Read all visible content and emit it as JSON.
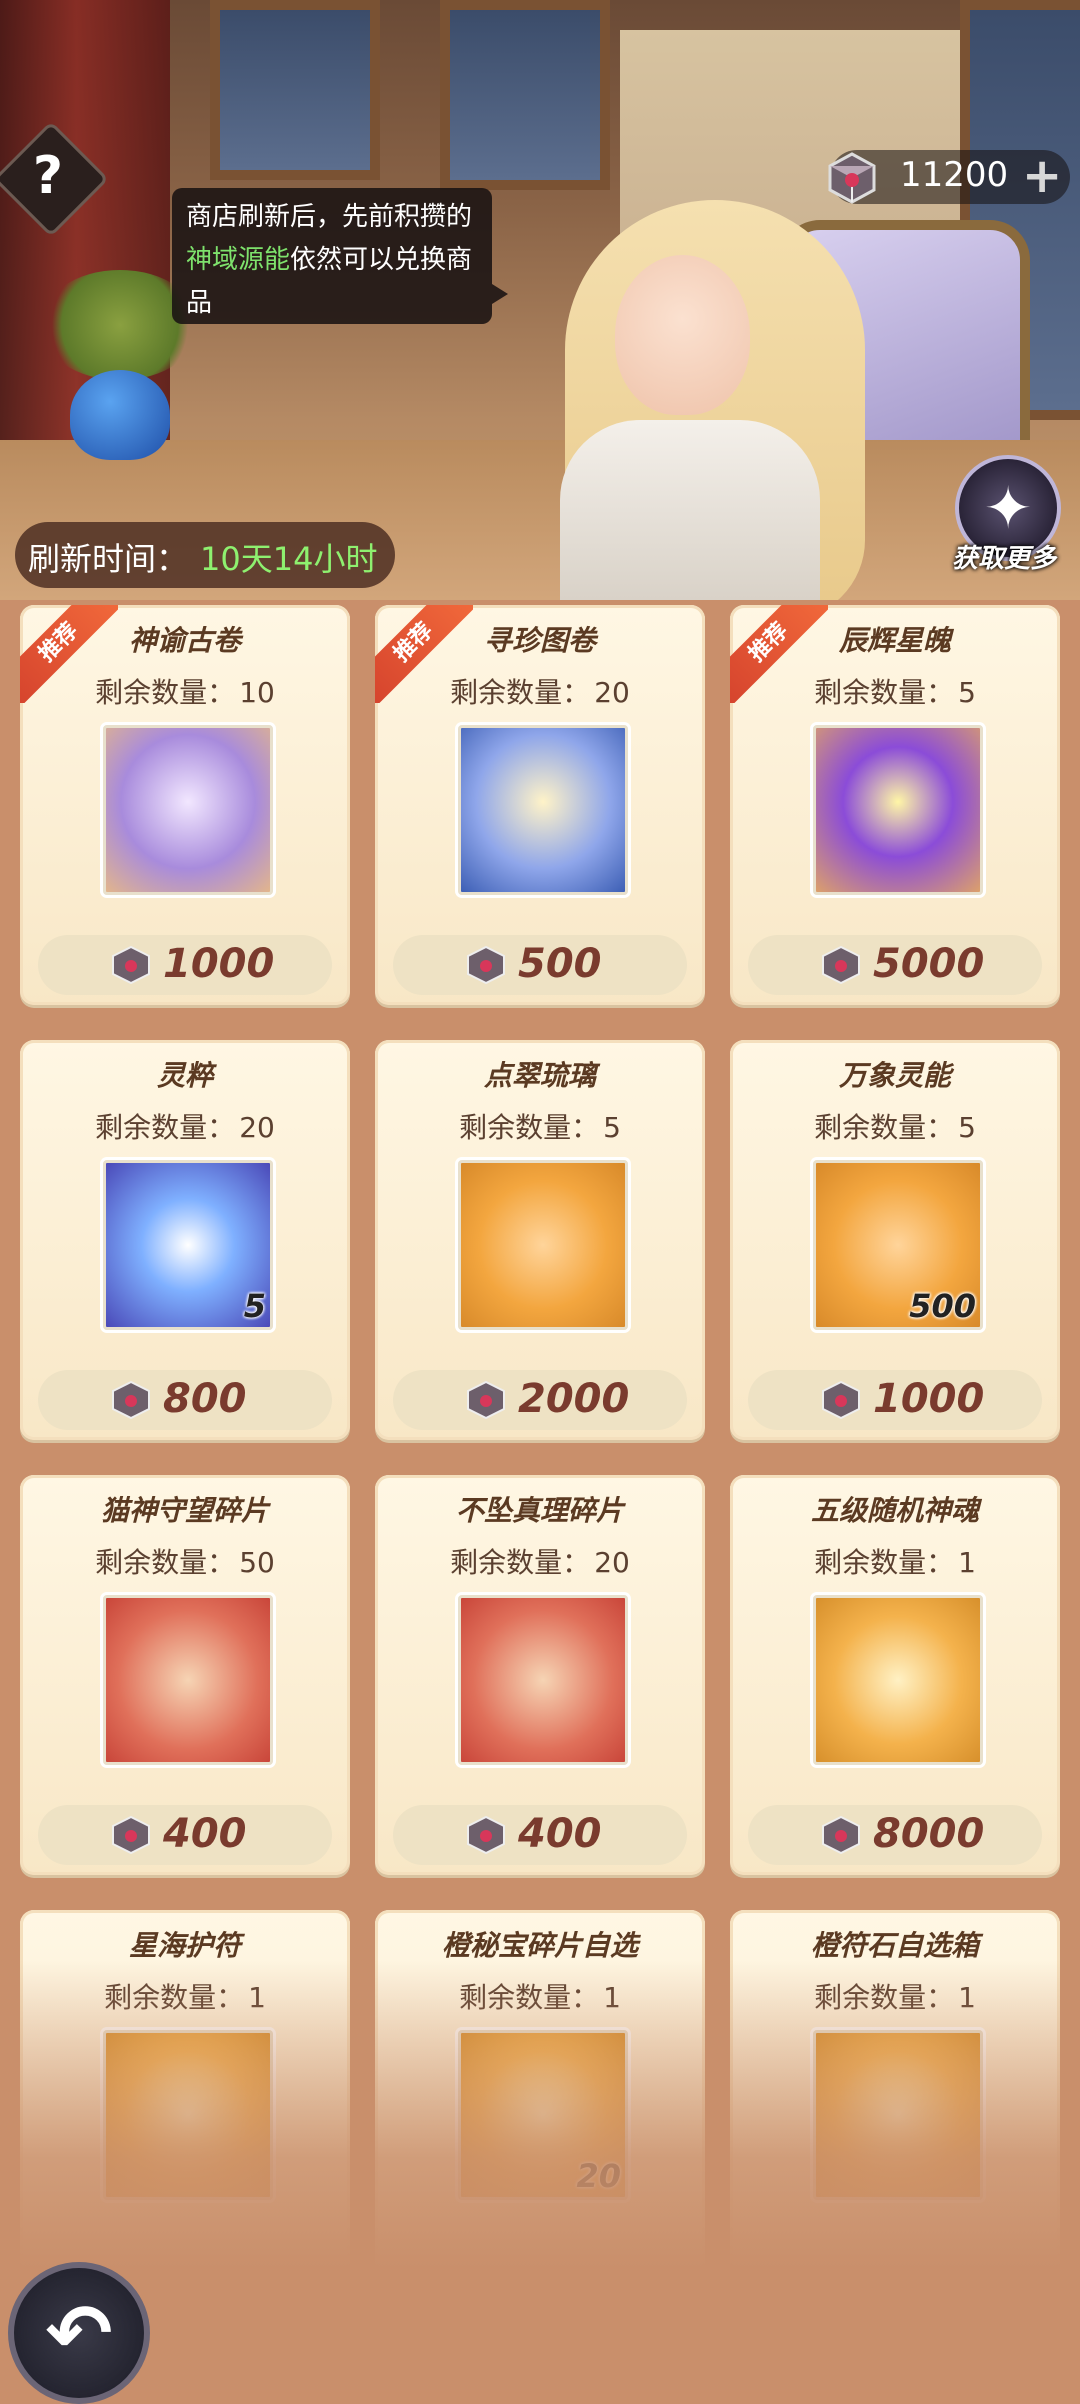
{
  "header": {
    "help_symbol": "?",
    "tooltip": {
      "part1": "商店刷新后，先前积攒的",
      "highlight": "神域源能",
      "part2": "依然可以兑换商品"
    },
    "currency": {
      "icon": "gem-chest-icon",
      "value": "11200",
      "plus": "+"
    },
    "get_more_label": "获取更多",
    "refresh": {
      "label": "刷新时间：",
      "value": "10天14小时"
    }
  },
  "shop": {
    "remain_label": "剩余数量：",
    "recommend_tag": "推荐",
    "items": [
      {
        "name": "神谕古卷",
        "remain": "10",
        "price": "1000",
        "recommended": true,
        "badge": "",
        "icon": "scroll-icon"
      },
      {
        "name": "寻珍图卷",
        "remain": "20",
        "price": "500",
        "recommended": true,
        "badge": "",
        "icon": "treasure-scroll-icon"
      },
      {
        "name": "辰辉星魄",
        "remain": "5",
        "price": "5000",
        "recommended": true,
        "badge": "",
        "icon": "star-orb-icon"
      },
      {
        "name": "灵粹",
        "remain": "20",
        "price": "800",
        "recommended": false,
        "badge": "5",
        "icon": "spirit-essence-icon"
      },
      {
        "name": "点翠琉璃",
        "remain": "5",
        "price": "2000",
        "recommended": false,
        "badge": "",
        "icon": "glass-gem-icon"
      },
      {
        "name": "万象灵能",
        "remain": "5",
        "price": "1000",
        "recommended": false,
        "badge": "500",
        "icon": "energy-crystal-icon"
      },
      {
        "name": "猫神守望碎片",
        "remain": "50",
        "price": "400",
        "recommended": false,
        "badge": "",
        "icon": "cat-god-portrait-icon"
      },
      {
        "name": "不坠真理碎片",
        "remain": "20",
        "price": "400",
        "recommended": false,
        "badge": "",
        "icon": "truth-hero-portrait-icon"
      },
      {
        "name": "五级随机神魂",
        "remain": "1",
        "price": "8000",
        "recommended": false,
        "badge": "",
        "icon": "random-soul-icon"
      },
      {
        "name": "星海护符",
        "remain": "1",
        "price": "",
        "recommended": false,
        "badge": "",
        "icon": "amulet-icon"
      },
      {
        "name": "橙秘宝碎片自选",
        "remain": "1",
        "price": "",
        "recommended": false,
        "badge": "20",
        "icon": "treasure-chest-icon"
      },
      {
        "name": "橙符石自选箱",
        "remain": "1",
        "price": "",
        "recommended": false,
        "badge": "",
        "icon": "rune-box-icon"
      }
    ]
  },
  "colors": {
    "highlight_green": "#7ee26c",
    "price_red": "#7a3b2e",
    "card_bg": "#fff7e4"
  }
}
